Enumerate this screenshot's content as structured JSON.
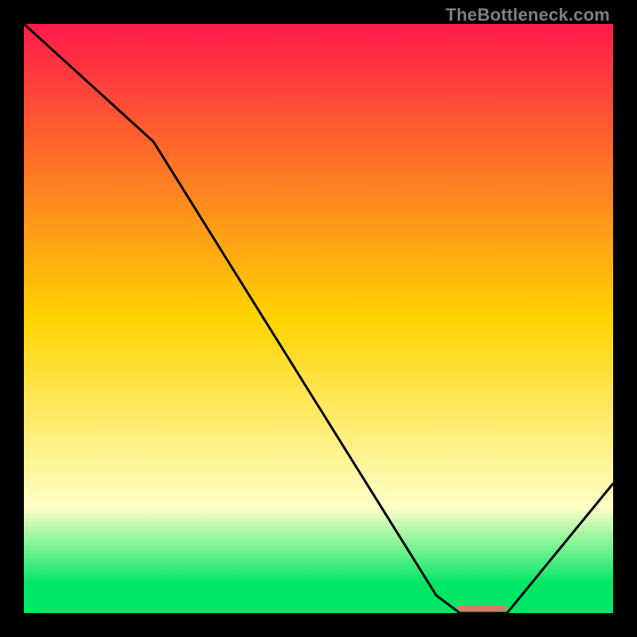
{
  "watermark": "TheBottleneck.com",
  "colors": {
    "curve": "#000000",
    "marker": "#e8736b",
    "top": "#ff1a4b",
    "mid": "#ffd400",
    "pale": "#ffffc8",
    "green": "#00e765",
    "black": "#000000"
  },
  "chart_data": {
    "type": "line",
    "title": "",
    "xlabel": "",
    "ylabel": "",
    "xlim": [
      0,
      100
    ],
    "ylim": [
      0,
      100
    ],
    "grid": false,
    "legend": false,
    "x": [
      0,
      22,
      70,
      74,
      82,
      100
    ],
    "values": [
      100,
      80,
      3,
      0,
      0,
      22
    ],
    "optimum_marker": {
      "x_start": 74,
      "x_end": 82,
      "y": 0
    },
    "gradient_stops": [
      {
        "offset": 0.0,
        "color": "#ff1a4b"
      },
      {
        "offset": 0.5,
        "color": "#ffd400"
      },
      {
        "offset": 0.82,
        "color": "#ffffc8"
      },
      {
        "offset": 0.95,
        "color": "#00e765"
      },
      {
        "offset": 1.0,
        "color": "#00e765"
      }
    ]
  }
}
